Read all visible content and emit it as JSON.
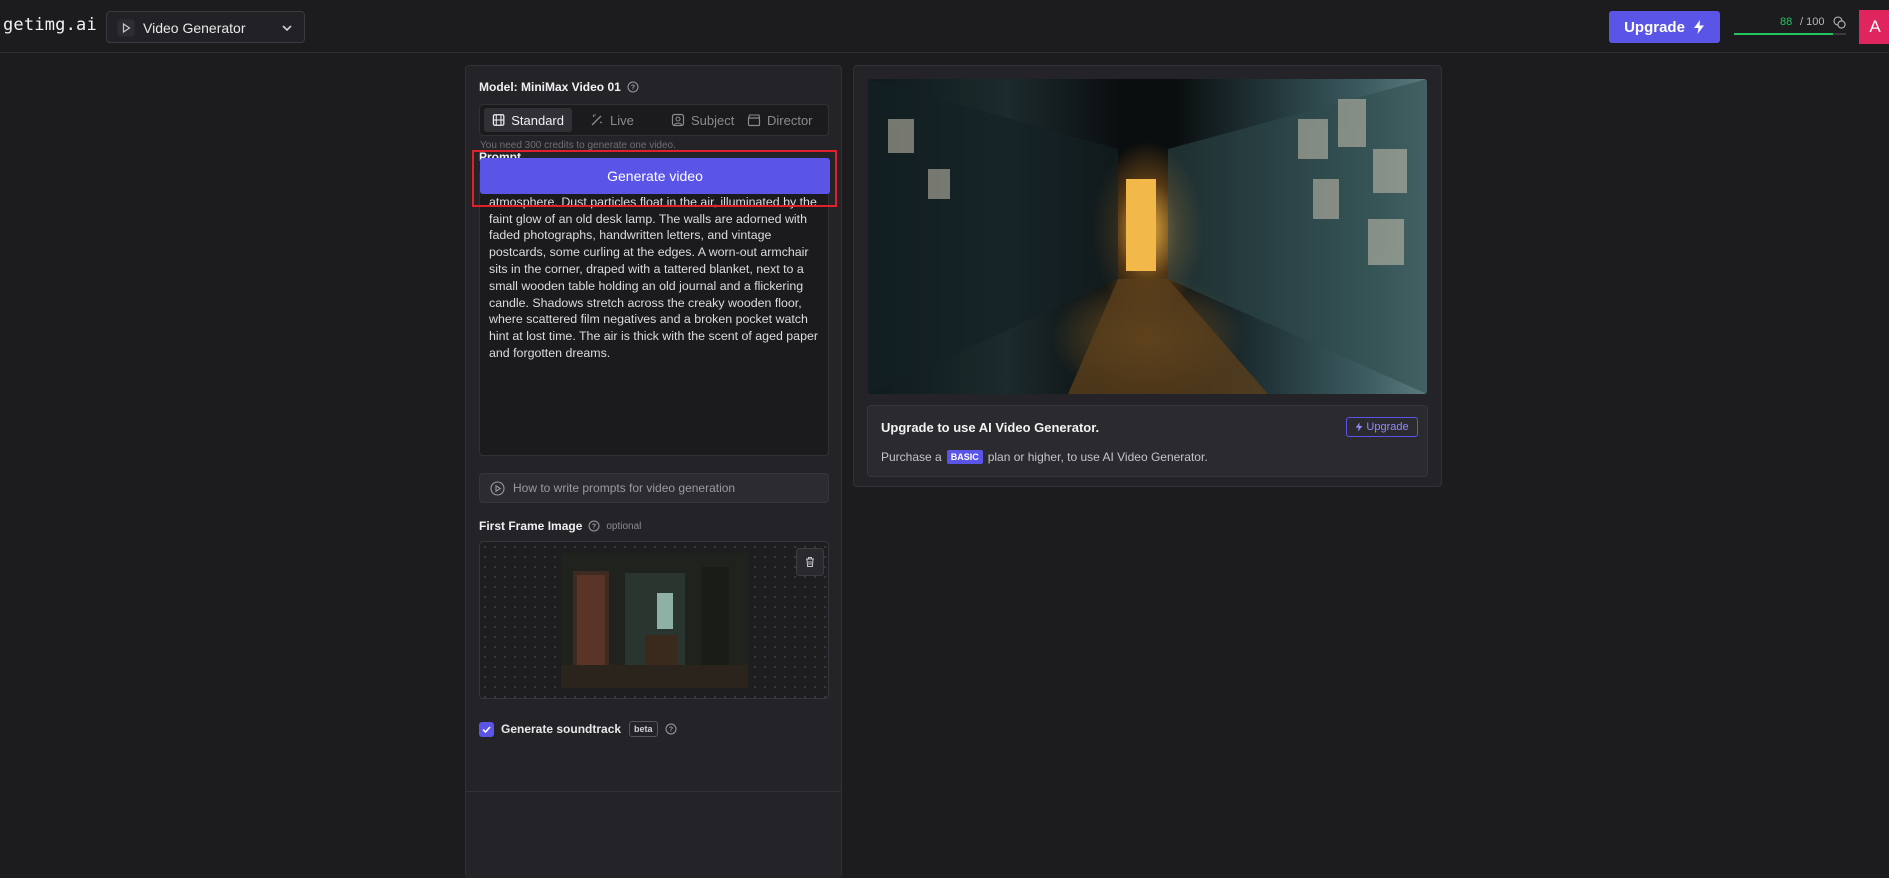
{
  "brand": {
    "logo": "getimg.ai"
  },
  "header": {
    "tool_select_label": "Video Generator",
    "upgrade_label": "Upgrade",
    "credits_current": "88",
    "credits_total": "/ 100",
    "credits_fraction": 0.88,
    "avatar_initial": "A"
  },
  "model": {
    "label": "Model: MiniMax Video 01"
  },
  "tabs": [
    {
      "label": "Standard",
      "icon": "film-icon",
      "active": true
    },
    {
      "label": "Live",
      "icon": "magic-wand-icon",
      "active": false
    },
    {
      "label": "Subject",
      "icon": "person-icon",
      "active": false
    },
    {
      "label": "Director",
      "icon": "clapperboard-icon",
      "active": false
    }
  ],
  "prompt": {
    "label": "Prompt",
    "value": "A dimly lit room filled with a nostalgic, melancholic atmosphere. Dust particles float in the air, illuminated by the faint glow of an old desk lamp. The walls are adorned with faded photographs, handwritten letters, and vintage postcards, some curling at the edges. A worn-out armchair sits in the corner, draped with a tattered blanket, next to a small wooden table holding an old journal and a flickering candle. Shadows stretch across the creaky wooden floor, where scattered film negatives and a broken pocket watch hint at lost time. The air is thick with the scent of aged paper and forgotten dreams."
  },
  "howto": {
    "label": "How to write prompts for video generation"
  },
  "first_frame": {
    "label": "First Frame Image",
    "optional": "optional"
  },
  "soundtrack": {
    "label": "Generate soundtrack",
    "badge": "beta",
    "checked": true
  },
  "footer": {
    "credits_note": "You need 300 credits to generate one video.",
    "generate_label": "Generate video"
  },
  "upgrade_card": {
    "title": "Upgrade to use AI Video Generator.",
    "button_label": "Upgrade",
    "text_before": "Purchase a",
    "plan_badge": "BASIC",
    "text_after": "plan or higher, to use AI Video Generator."
  },
  "colors": {
    "accent": "#5a55e6",
    "credits_green": "#22c55e",
    "highlight_red": "#e0202a",
    "avatar": "#e0245e"
  }
}
